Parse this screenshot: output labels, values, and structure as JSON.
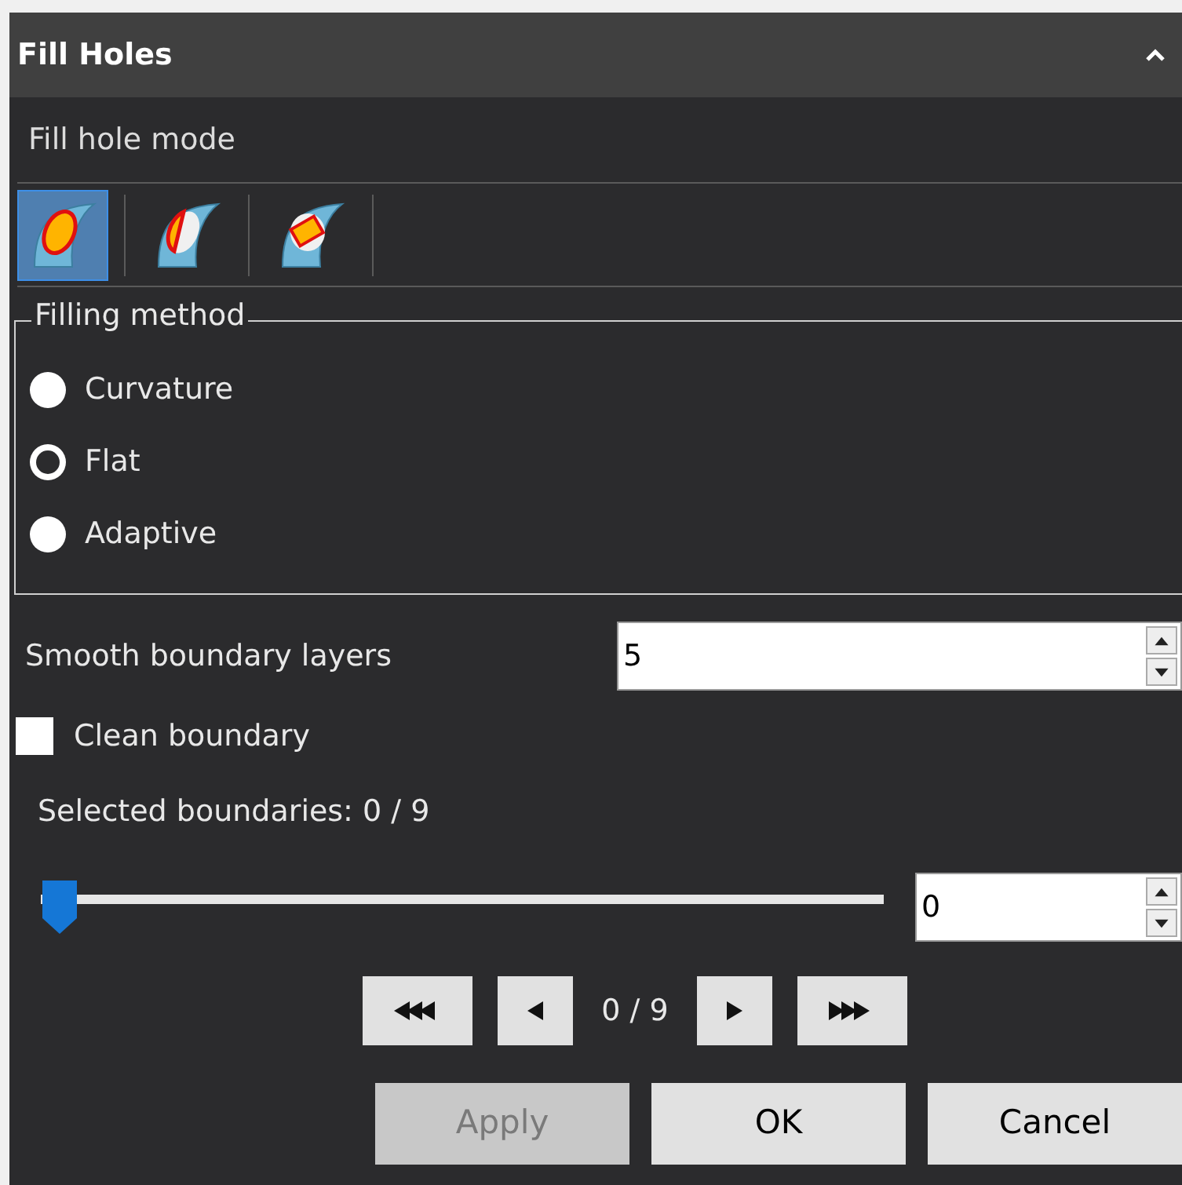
{
  "panel": {
    "title": "Fill Holes",
    "expanded": true
  },
  "fill_hole_mode": {
    "label": "Fill hole mode",
    "modes": [
      {
        "kind": "full",
        "selected": true
      },
      {
        "kind": "half",
        "selected": false
      },
      {
        "kind": "bridge",
        "selected": false
      }
    ]
  },
  "filling_method": {
    "title": "Filling method",
    "options": [
      {
        "label": "Curvature",
        "selected": false
      },
      {
        "label": "Flat",
        "selected": true
      },
      {
        "label": "Adaptive",
        "selected": false
      }
    ]
  },
  "smooth_boundary_layers": {
    "label": "Smooth boundary layers",
    "value": "5"
  },
  "clean_boundary": {
    "label": "Clean boundary",
    "checked": false
  },
  "selected_boundaries": {
    "label": "Selected boundaries: 0 / 9",
    "level": 0,
    "value": "0"
  },
  "navigation": {
    "counter": "0 / 9"
  },
  "buttons": [
    {
      "label": "Apply",
      "disabled": true
    },
    {
      "label": "OK",
      "disabled": false
    },
    {
      "label": "Cancel",
      "disabled": false
    }
  ]
}
